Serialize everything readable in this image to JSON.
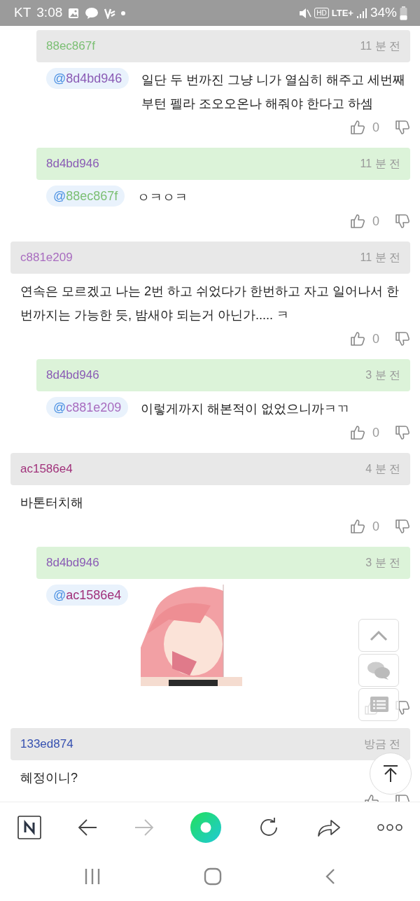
{
  "status_bar": {
    "carrier": "KT",
    "time": "3:08",
    "hd": "HD",
    "network": "LTE+",
    "battery": "34%"
  },
  "comments": [
    {
      "author": "88ec867f",
      "color": "#7bbf73",
      "time": "11 분 전",
      "reply": true,
      "highlight": false,
      "kind": "text",
      "mention": {
        "prefix": "@",
        "name": "8d4bd946",
        "color": "#8a5bb5"
      },
      "text": "일단 두 번까진 그냥 니가 열심히 해주고 세번째 부턴 펠라 조오오온나 해줘야 한다고 하셈",
      "up": "0"
    },
    {
      "author": "8d4bd946",
      "color": "#8a5bb5",
      "time": "11 분 전",
      "reply": true,
      "highlight": true,
      "kind": "text",
      "mention": {
        "prefix": "@",
        "name": "88ec867f",
        "color": "#7bbf73"
      },
      "text": "ㅇㅋㅇㅋ",
      "up": "0"
    },
    {
      "author": "c881e209",
      "color": "#a86cbf",
      "time": "11 분 전",
      "reply": false,
      "highlight": false,
      "kind": "text",
      "text": "연속은 모르겠고 나는 2번 하고 쉬었다가 한번하고 자고 일어나서 한번까지는 가능한 듯, 밤새야 되는거 아닌가..... ㅋ",
      "up": "0"
    },
    {
      "author": "8d4bd946",
      "color": "#8a5bb5",
      "time": "3 분 전",
      "reply": true,
      "highlight": true,
      "kind": "text",
      "mention": {
        "prefix": "@",
        "name": "c881e209",
        "color": "#a86cbf"
      },
      "text": "이렇게까지 해본적이 없었으니까ㅋㄲ",
      "up": "0"
    },
    {
      "author": "ac1586e4",
      "color": "#a0307a",
      "time": "4 분 전",
      "reply": false,
      "highlight": false,
      "kind": "text",
      "text": "바톤터치해",
      "up": "0"
    },
    {
      "author": "8d4bd946",
      "color": "#8a5bb5",
      "time": "3 분 전",
      "reply": true,
      "highlight": true,
      "kind": "sticker",
      "mention": {
        "prefix": "@",
        "name": "ac1586e4",
        "color": "#a0307a"
      }
    },
    {
      "author": "133ed874",
      "color": "#3550b0",
      "time": "방금 전",
      "reply": false,
      "highlight": false,
      "kind": "text",
      "text": "혜정이니?"
    }
  ],
  "browser_toolbar": {
    "forward": {
      "disabled": true
    }
  }
}
